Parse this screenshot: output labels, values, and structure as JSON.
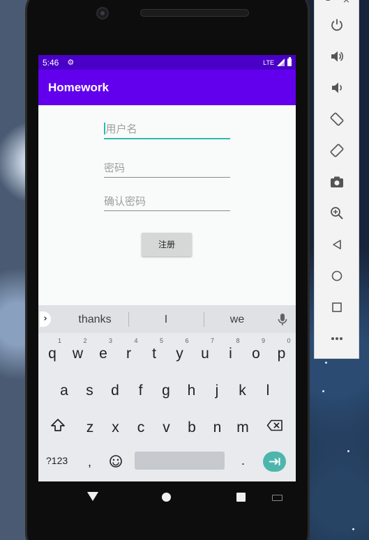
{
  "status_bar": {
    "time": "5:46",
    "network": "LTE"
  },
  "app_bar": {
    "title": "Homework"
  },
  "form": {
    "username_placeholder": "用户名",
    "password_placeholder": "密码",
    "confirm_placeholder": "确认密码",
    "register_label": "注册"
  },
  "keyboard": {
    "suggestions": [
      "thanks",
      "I",
      "we"
    ],
    "row1": [
      {
        "k": "q",
        "hint": "1"
      },
      {
        "k": "w",
        "hint": "2"
      },
      {
        "k": "e",
        "hint": "3"
      },
      {
        "k": "r",
        "hint": "4"
      },
      {
        "k": "t",
        "hint": "5"
      },
      {
        "k": "y",
        "hint": "6"
      },
      {
        "k": "u",
        "hint": "7"
      },
      {
        "k": "i",
        "hint": "8"
      },
      {
        "k": "o",
        "hint": "9"
      },
      {
        "k": "p",
        "hint": "0"
      }
    ],
    "row2": [
      "a",
      "s",
      "d",
      "f",
      "g",
      "h",
      "j",
      "k",
      "l"
    ],
    "row3": [
      "z",
      "x",
      "c",
      "v",
      "b",
      "n",
      "m"
    ],
    "symbols_label": "?123",
    "comma": ",",
    "period": "."
  },
  "emulator_toolbar": {
    "window_buttons": [
      "–",
      "×"
    ],
    "buttons": [
      "power-icon",
      "volume-up-icon",
      "volume-down-icon",
      "rotate-left-icon",
      "rotate-right-icon",
      "camera-icon",
      "zoom-icon",
      "back-icon",
      "home-icon",
      "overview-icon",
      "more-icon"
    ]
  },
  "colors": {
    "status_bar": "#4a00c7",
    "app_bar": "#6200ee",
    "accent": "#2bbbad",
    "enter_key": "#4db6ac"
  }
}
